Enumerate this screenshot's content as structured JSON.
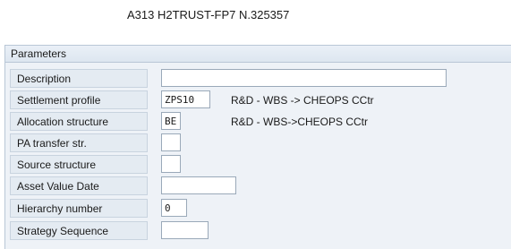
{
  "header": {
    "object_title": "A313 H2TRUST-FP7 N.325357"
  },
  "panel": {
    "title": "Parameters"
  },
  "rows": [
    {
      "label": "Description",
      "value": "",
      "description": ""
    },
    {
      "label": "Settlement profile",
      "value": "ZPS10",
      "description": "R&D - WBS -> CHEOPS CCtr"
    },
    {
      "label": "Allocation structure",
      "value": "BE",
      "description": "R&D - WBS->CHEOPS CCtr"
    },
    {
      "label": "PA transfer str.",
      "value": "",
      "description": ""
    },
    {
      "label": "Source structure",
      "value": "",
      "description": ""
    },
    {
      "label": "Asset Value Date",
      "value": "",
      "description": ""
    },
    {
      "label": "Hierarchy number",
      "value": "0",
      "description": ""
    },
    {
      "label": "Strategy Sequence",
      "value": "",
      "description": ""
    }
  ]
}
